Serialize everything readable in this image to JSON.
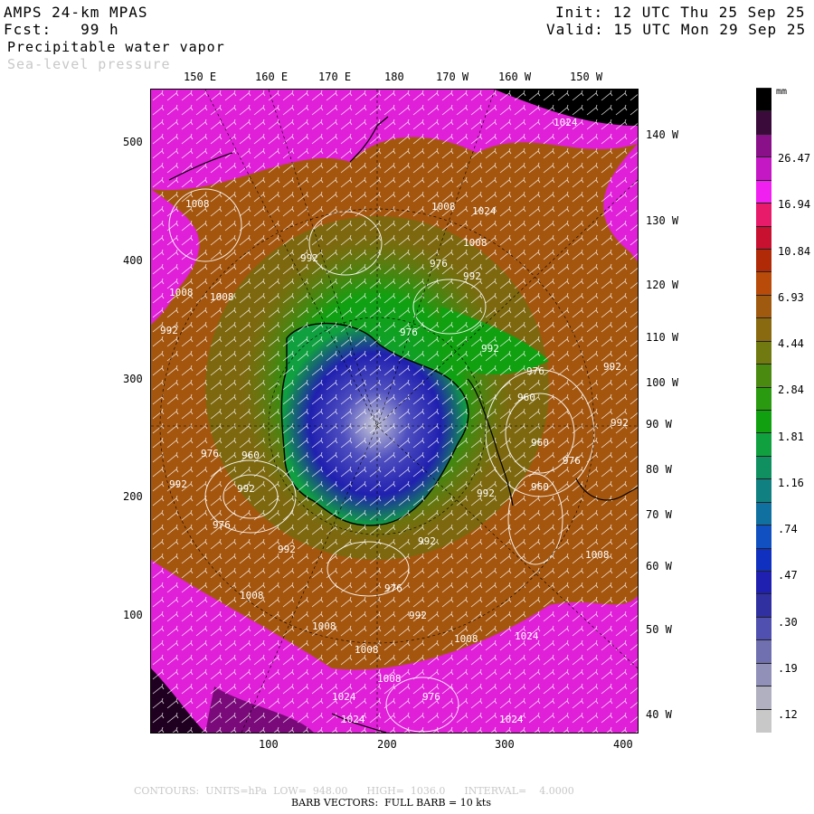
{
  "header": {
    "model": "AMPS 24-km MPAS",
    "forecast": "Fcst:   99 h",
    "field1": "Precipitable water vapor",
    "field2": "Sea-level pressure",
    "init": "Init: 12 UTC Thu 25 Sep 25",
    "valid": "Valid: 15 UTC Mon 29 Sep 25"
  },
  "top_longitudes": [
    "150 E",
    "160 E",
    "170 E",
    "180",
    "170 W",
    "160 W",
    "150 W"
  ],
  "right_longitudes": [
    "140 W",
    "130 W",
    "120 W",
    "110 W",
    "100 W",
    "90 W",
    "80 W",
    "70 W",
    "60 W",
    "50 W",
    "40 W"
  ],
  "y_ticks": [
    "500",
    "400",
    "300",
    "200",
    "100"
  ],
  "x_ticks": [
    "100",
    "200",
    "300",
    "400"
  ],
  "colorbar": {
    "unit": "mm",
    "labels": [
      "26.47",
      "16.94",
      "10.84",
      "6.93",
      "4.44",
      "2.84",
      "1.81",
      "1.16",
      ".74",
      ".47",
      ".30",
      ".19",
      ".12"
    ],
    "colors": [
      "#000000",
      "#3a0a3a",
      "#8a108a",
      "#c418c4",
      "#f020f0",
      "#e81a6a",
      "#c81030",
      "#b02a08",
      "#b84a0a",
      "#a05a10",
      "#8a6a10",
      "#707a10",
      "#4a8a10",
      "#2a9a10",
      "#10a010",
      "#10a040",
      "#109060",
      "#108080",
      "#1070a0",
      "#1050c0",
      "#1030c0",
      "#2020b0",
      "#3030a0",
      "#5050b0",
      "#7070b0",
      "#9090b8",
      "#b0b0c0",
      "#c8c8c8"
    ]
  },
  "isobars": [
    {
      "label": "1024",
      "color": "#ffffff"
    },
    {
      "label": "1008",
      "color": "#ffffff"
    },
    {
      "label": "1008",
      "color": "#ffffff"
    },
    {
      "label": "1024",
      "color": "#ffffff"
    },
    {
      "label": "1008",
      "color": "#ffffff"
    },
    {
      "label": "992",
      "color": "#ffffff"
    },
    {
      "label": "976",
      "color": "#ffffff"
    },
    {
      "label": "992",
      "color": "#ffffff"
    },
    {
      "label": "1008",
      "color": "#ffffff"
    },
    {
      "label": "1008",
      "color": "#ffffff"
    },
    {
      "label": "992",
      "color": "#ffffff"
    },
    {
      "label": "976",
      "color": "#ffffff"
    },
    {
      "label": "992",
      "color": "#ffffff"
    },
    {
      "label": "976",
      "color": "#ffffff"
    },
    {
      "label": "960",
      "color": "#ffffff"
    },
    {
      "label": "992",
      "color": "#ffffff"
    },
    {
      "label": "992",
      "color": "#ffffff"
    },
    {
      "label": "976",
      "color": "#ffffff"
    },
    {
      "label": "960",
      "color": "#ffffff"
    },
    {
      "label": "960",
      "color": "#ffffff"
    },
    {
      "label": "976",
      "color": "#ffffff"
    },
    {
      "label": "992",
      "color": "#ffffff"
    },
    {
      "label": "976",
      "color": "#ffffff"
    },
    {
      "label": "992",
      "color": "#ffffff"
    },
    {
      "label": "992",
      "color": "#ffffff"
    },
    {
      "label": "1008",
      "color": "#ffffff"
    },
    {
      "label": "992",
      "color": "#ffffff"
    },
    {
      "label": "976",
      "color": "#ffffff"
    },
    {
      "label": "992",
      "color": "#ffffff"
    },
    {
      "label": "1008",
      "color": "#ffffff"
    },
    {
      "label": "1008",
      "color": "#ffffff"
    },
    {
      "label": "1024",
      "color": "#ffffff"
    },
    {
      "label": "1008",
      "color": "#ffffff"
    },
    {
      "label": "1008",
      "color": "#ffffff"
    },
    {
      "label": "1024",
      "color": "#ffffff"
    },
    {
      "label": "1024",
      "color": "#ffffff"
    },
    {
      "label": "1024",
      "color": "#ffffff"
    },
    {
      "label": "1008",
      "color": "#ffffff"
    },
    {
      "label": "992",
      "color": "#ffffff"
    },
    {
      "label": "960",
      "color": "#ffffff"
    },
    {
      "label": "976",
      "color": "#ffffff"
    }
  ],
  "footer": {
    "contours": "CONTOURS:  UNITS=hPa  LOW=  948.00      HIGH=  1036.0      INTERVAL=    4.0000",
    "barbs": "BARB VECTORS:  FULL BARB = 10 kts"
  }
}
